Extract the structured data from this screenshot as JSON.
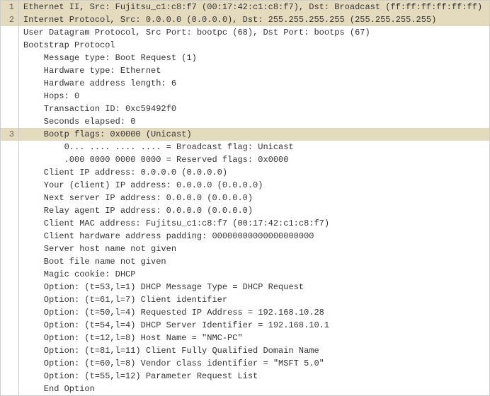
{
  "lines": [
    {
      "num": "1",
      "hl": true,
      "indent": 0,
      "text": "Ethernet II, Src: Fujitsu_c1:c8:f7 (00:17:42:c1:c8:f7), Dst: Broadcast (ff:ff:ff:ff:ff:ff)"
    },
    {
      "num": "2",
      "hl": true,
      "indent": 0,
      "text": "Internet Protocol, Src: 0.0.0.0 (0.0.0.0), Dst: 255.255.255.255 (255.255.255.255)"
    },
    {
      "num": "",
      "hl": false,
      "indent": 0,
      "text": "User Datagram Protocol, Src Port: bootpc (68), Dst Port: bootps (67)"
    },
    {
      "num": "",
      "hl": false,
      "indent": 0,
      "text": "Bootstrap Protocol"
    },
    {
      "num": "",
      "hl": false,
      "indent": 1,
      "text": "Message type: Boot Request (1)"
    },
    {
      "num": "",
      "hl": false,
      "indent": 1,
      "text": "Hardware type: Ethernet"
    },
    {
      "num": "",
      "hl": false,
      "indent": 1,
      "text": "Hardware address length: 6"
    },
    {
      "num": "",
      "hl": false,
      "indent": 1,
      "text": "Hops: 0"
    },
    {
      "num": "",
      "hl": false,
      "indent": 1,
      "text": "Transaction ID: 0xc59492f0"
    },
    {
      "num": "",
      "hl": false,
      "indent": 1,
      "text": "Seconds elapsed: 0"
    },
    {
      "num": "3",
      "hl": true,
      "indent": 1,
      "text": "Bootp flags: 0x0000 (Unicast)"
    },
    {
      "num": "",
      "hl": false,
      "indent": 2,
      "text": "0... .... .... .... = Broadcast flag: Unicast"
    },
    {
      "num": "",
      "hl": false,
      "indent": 2,
      "text": ".000 0000 0000 0000 = Reserved flags: 0x0000"
    },
    {
      "num": "",
      "hl": false,
      "indent": 1,
      "text": "Client IP address: 0.0.0.0 (0.0.0.0)"
    },
    {
      "num": "",
      "hl": false,
      "indent": 1,
      "text": "Your (client) IP address: 0.0.0.0 (0.0.0.0)"
    },
    {
      "num": "",
      "hl": false,
      "indent": 1,
      "text": "Next server IP address: 0.0.0.0 (0.0.0.0)"
    },
    {
      "num": "",
      "hl": false,
      "indent": 1,
      "text": "Relay agent IP address: 0.0.0.0 (0.0.0.0)"
    },
    {
      "num": "",
      "hl": false,
      "indent": 1,
      "text": "Client MAC address: Fujitsu_c1:c8:f7 (00:17:42:c1:c8:f7)"
    },
    {
      "num": "",
      "hl": false,
      "indent": 1,
      "text": "Client hardware address padding: 00000000000000000000"
    },
    {
      "num": "",
      "hl": false,
      "indent": 1,
      "text": "Server host name not given"
    },
    {
      "num": "",
      "hl": false,
      "indent": 1,
      "text": "Boot file name not given"
    },
    {
      "num": "",
      "hl": false,
      "indent": 1,
      "text": "Magic cookie: DHCP"
    },
    {
      "num": "",
      "hl": false,
      "indent": 1,
      "text": "Option: (t=53,l=1) DHCP Message Type = DHCP Request"
    },
    {
      "num": "",
      "hl": false,
      "indent": 1,
      "text": "Option: (t=61,l=7) Client identifier"
    },
    {
      "num": "",
      "hl": false,
      "indent": 1,
      "text": "Option: (t=50,l=4) Requested IP Address = 192.168.10.28"
    },
    {
      "num": "",
      "hl": false,
      "indent": 1,
      "text": "Option: (t=54,l=4) DHCP Server Identifier = 192.168.10.1"
    },
    {
      "num": "",
      "hl": false,
      "indent": 1,
      "text": "Option: (t=12,l=8) Host Name = \"NMC-PC\""
    },
    {
      "num": "",
      "hl": false,
      "indent": 1,
      "text": "Option: (t=81,l=11) Client Fully Qualified Domain Name"
    },
    {
      "num": "",
      "hl": false,
      "indent": 1,
      "text": "Option: (t=60,l=8) Vendor class identifier = \"MSFT 5.0\""
    },
    {
      "num": "",
      "hl": false,
      "indent": 1,
      "text": "Option: (t=55,l=12) Parameter Request List"
    },
    {
      "num": "",
      "hl": false,
      "indent": 1,
      "text": "End Option"
    }
  ]
}
